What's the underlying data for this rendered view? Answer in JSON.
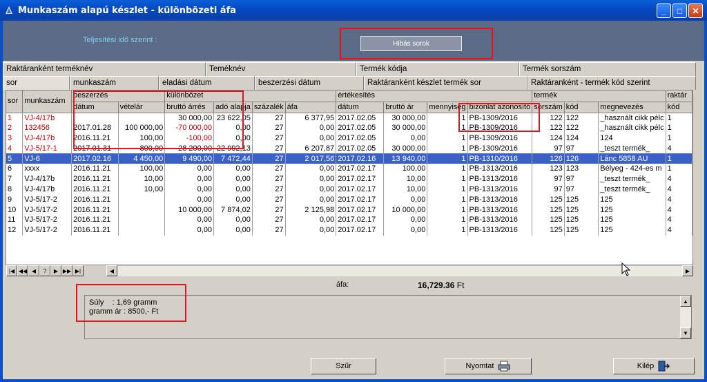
{
  "window": {
    "title": "Munkaszám alapú készlet - különbözeti áfa",
    "buttons": [
      "_",
      "□",
      "X"
    ]
  },
  "top": {
    "perf_label": "Teljesítési idő szerint :",
    "error_button": "Hibás sorok"
  },
  "tabs_row1": [
    "Raktáranként terméknév",
    "Teméknév",
    "Termék kódja",
    "Termék sorszám"
  ],
  "tabs_row2": [
    "sor",
    "munkaszám",
    "eladási dátum",
    "beszerzési dátum",
    "Raktáranként készlet termék sor",
    "Raktáranként - termék kód szerint"
  ],
  "grid": {
    "groups": [
      "beszerzés",
      "különbözet",
      "értékesítés",
      "termék",
      "raktár"
    ],
    "headers": [
      "sor",
      "munkaszám",
      "dátum",
      "vételár",
      "bruttó árrés",
      "adó alapja",
      "százalék",
      "áfa",
      "dátum",
      "bruttó ár",
      "mennyiség",
      "bizonlat azonosító",
      "sorszám",
      "kód",
      "megnevezés",
      "kód"
    ],
    "rows": [
      [
        "1",
        "VJ-4/17b",
        "",
        "",
        "30 000,00",
        "23 622,05",
        "27",
        "6 377,95",
        "2017.02.05",
        "30 000,00",
        "1",
        "PB-1309/2016",
        "122",
        "122",
        "_használt cikk pélc",
        "1"
      ],
      [
        "2",
        "132456",
        "2017.01.28",
        "100 000,00",
        "-70 000,00",
        "0,00",
        "27",
        "0,00",
        "2017.02.05",
        "30 000,00",
        "1",
        "PB-1309/2016",
        "122",
        "122",
        "_használt cikk pélc",
        "1"
      ],
      [
        "3",
        "VJ-4/17b",
        "2016.11.21",
        "100,00",
        "-100,00",
        "0,00",
        "27",
        "0,00",
        "2017.02.05",
        "0,00",
        "1",
        "PB-1309/2016",
        "124",
        "124",
        "124",
        "1"
      ],
      [
        "4",
        "VJ-5/17-1",
        "2017.01.31",
        "800,00",
        "28 200,00",
        "22 992,13",
        "27",
        "6 207,87",
        "2017.02.05",
        "30 000,00",
        "1",
        "PB-1309/2016",
        "97",
        "97",
        "_teszt termék_",
        "4"
      ],
      [
        "5",
        "VJ-6",
        "2017.02.16",
        "4 450,00",
        "9 490,00",
        "7 472,44",
        "27",
        "2 017,56",
        "2017.02.16",
        "13 940,00",
        "1",
        "PB-1310/2016",
        "126",
        "126",
        "Lánc 5858 AU",
        "1"
      ],
      [
        "6",
        "xxxx",
        "2016.11.21",
        "100,00",
        "0,00",
        "0,00",
        "27",
        "0,00",
        "2017.02.17",
        "100,00",
        "1",
        "PB-1313/2016",
        "123",
        "123",
        "Bélyeg - 424-es m",
        "1"
      ],
      [
        "7",
        "VJ-4/17b",
        "2016.11.21",
        "10,00",
        "0,00",
        "0,00",
        "27",
        "0,00",
        "2017.02.17",
        "10,00",
        "1",
        "PB-1313/2016",
        "97",
        "97",
        "_teszt termék_",
        "4"
      ],
      [
        "8",
        "VJ-4/17b",
        "2016.11.21",
        "10,00",
        "0,00",
        "0,00",
        "27",
        "0,00",
        "2017.02.17",
        "10,00",
        "1",
        "PB-1313/2016",
        "97",
        "97",
        "_teszt termék_",
        "4"
      ],
      [
        "9",
        "VJ-5/17-2",
        "2016.11.21",
        "",
        "0,00",
        "0,00",
        "27",
        "0,00",
        "2017.02.17",
        "0,00",
        "1",
        "PB-1313/2016",
        "125",
        "125",
        "125",
        "4"
      ],
      [
        "10",
        "VJ-5/17-2",
        "2016.11.21",
        "",
        "10 000,00",
        "7 874,02",
        "27",
        "2 125,98",
        "2017.02.17",
        "10 000,00",
        "1",
        "PB-1313/2016",
        "125",
        "125",
        "125",
        "4"
      ],
      [
        "11",
        "VJ-5/17-2",
        "2016.11.21",
        "",
        "0,00",
        "0,00",
        "27",
        "0,00",
        "2017.02.17",
        "0,00",
        "1",
        "PB-1313/2016",
        "125",
        "125",
        "125",
        "4"
      ],
      [
        "12",
        "VJ-5/17-2",
        "2016.11.21",
        "",
        "0,00",
        "0,00",
        "27",
        "0,00",
        "2017.02.17",
        "0,00",
        "1",
        "PB-1313/2016",
        "125",
        "125",
        "125",
        "4"
      ]
    ],
    "selected_row": 5
  },
  "navigator": [
    "|◀",
    "◀◀",
    "◀",
    "?",
    "▶",
    "▶▶",
    "▶|"
  ],
  "summary": {
    "afa_label": "áfa:",
    "afa_value": "16,729.36",
    "afa_unit": "Ft"
  },
  "memo": {
    "line1": "Súly    : 1,69 gramm",
    "line2": "gramm ár : 8500,- Ft"
  },
  "buttons": {
    "filter": "Szűr",
    "print": "Nyomtat",
    "exit": "Kilép"
  },
  "icons": [
    "app-icon",
    "printer-icon",
    "exit-icon"
  ]
}
